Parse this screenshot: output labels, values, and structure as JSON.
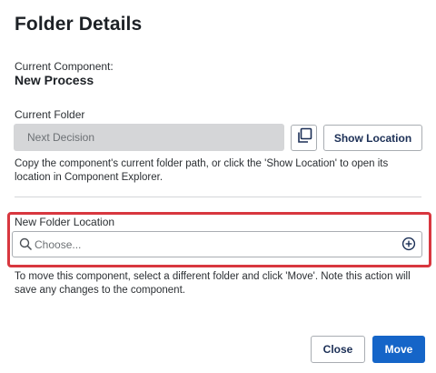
{
  "dialog": {
    "title": "Folder Details",
    "current_component": {
      "label": "Current Component:",
      "value": "New Process"
    },
    "current_folder": {
      "label": "Current Folder",
      "value": "Next Decision",
      "copy_icon": "copy-icon",
      "show_location_label": "Show Location",
      "help": "Copy the component's current folder path, or click the 'Show Location' to open its location in Component Explorer."
    },
    "new_folder": {
      "label": "New Folder Location",
      "placeholder": "Choose...",
      "value": "",
      "search_icon": "search-icon",
      "add_icon": "add-circle-icon",
      "highlight_color": "#d8373f",
      "help": "To move this component, select a different folder and click 'Move'. Note this action will save any changes to the component."
    },
    "buttons": {
      "close_label": "Close",
      "move_label": "Move"
    },
    "colors": {
      "primary": "#1565c8",
      "text_dark": "#1d2126",
      "button_text": "#1b2f56",
      "disabled_field": "#d5d6d8"
    }
  }
}
